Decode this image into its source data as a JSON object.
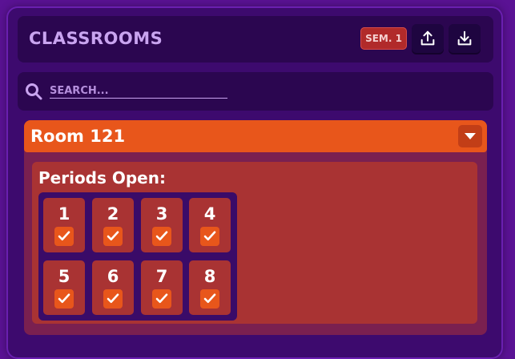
{
  "header": {
    "title": "CLASSROOMS",
    "semester_label": "SEM. 1",
    "upload_icon": "upload-icon",
    "download_icon": "download-icon"
  },
  "search": {
    "placeholder": "SEARCH...",
    "icon": "search-icon"
  },
  "room": {
    "name": "Room 121",
    "expanded": true,
    "periods_label": "Periods Open:",
    "periods": [
      {
        "number": "1",
        "checked": true
      },
      {
        "number": "2",
        "checked": true
      },
      {
        "number": "3",
        "checked": true
      },
      {
        "number": "4",
        "checked": true
      },
      {
        "number": "5",
        "checked": true
      },
      {
        "number": "6",
        "checked": true
      },
      {
        "number": "7",
        "checked": true
      },
      {
        "number": "8",
        "checked": true
      }
    ]
  },
  "colors": {
    "background": "#5a1294",
    "panel": "#2b0650",
    "accent_orange": "#e8561b",
    "room_body": "#a93333",
    "title_text": "#c9a4f0"
  }
}
